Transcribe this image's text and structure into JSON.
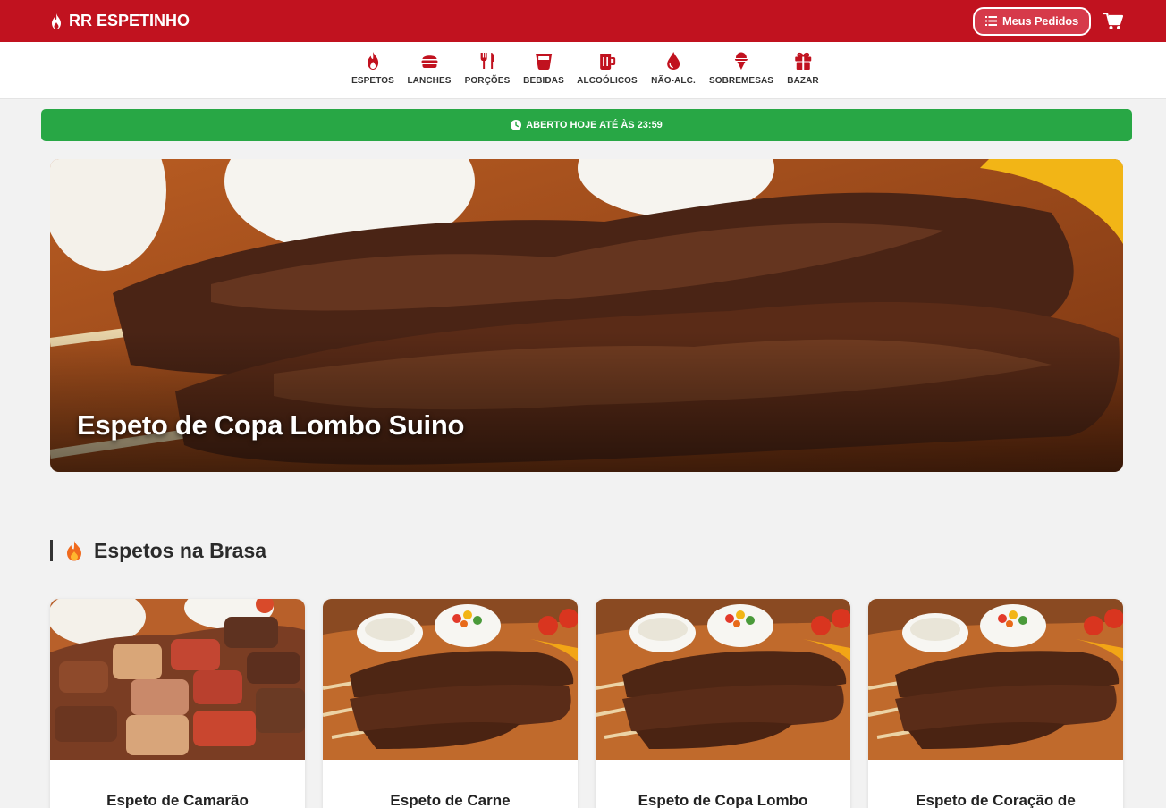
{
  "header": {
    "brand": "RR ESPETINHO",
    "orders_label": "Meus Pedidos",
    "brand_color": "#c1121f"
  },
  "categories": [
    {
      "label": "ESPETOS",
      "icon": "fire-icon"
    },
    {
      "label": "LANCHES",
      "icon": "burger-icon"
    },
    {
      "label": "PORÇÕES",
      "icon": "utensils-icon"
    },
    {
      "label": "BEBIDAS",
      "icon": "cup-icon"
    },
    {
      "label": "ALCOÓLICOS",
      "icon": "beer-mug-icon"
    },
    {
      "label": "NÃO-ALC.",
      "icon": "droplet-icon"
    },
    {
      "label": "SOBREMESAS",
      "icon": "ice-cream-icon"
    },
    {
      "label": "BAZAR",
      "icon": "gift-icon"
    }
  ],
  "status": {
    "text": "ABERTO HOJE ATÉ ÀS 23:59",
    "color": "#28a745"
  },
  "hero": {
    "title": "Espeto de Copa Lombo Suino"
  },
  "section": {
    "title": "Espetos na Brasa"
  },
  "products": [
    {
      "name": "Espeto de Camarão"
    },
    {
      "name": "Espeto de Carne"
    },
    {
      "name": "Espeto de Copa Lombo"
    },
    {
      "name": "Espeto de Coração de"
    }
  ]
}
